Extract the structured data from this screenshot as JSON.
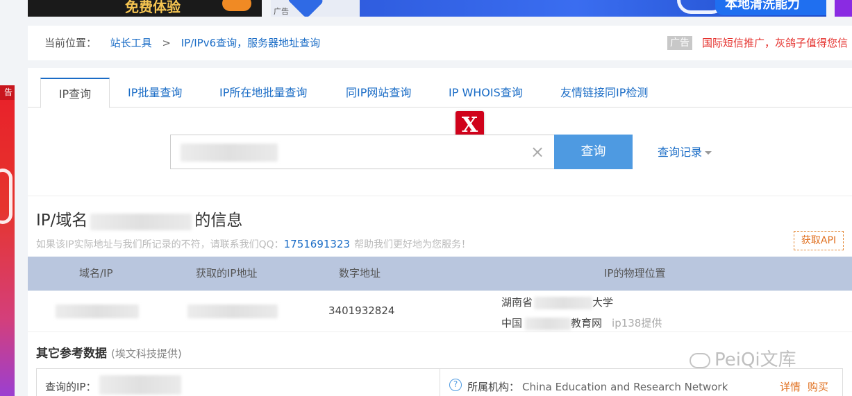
{
  "top_ads": {
    "ad1_text": "免费体验",
    "ad2_tag": "广告",
    "ad2_slogan": "本地清洗能力"
  },
  "side_ad": {
    "tag": "告"
  },
  "breadcrumb": {
    "prefix": "当前位置：",
    "items": [
      "站长工具",
      "IP/IPv6查询，服务器地址查询"
    ],
    "separator": ">",
    "ad_label": "广告",
    "ad_text": "国际短信推广，灰鸽子值得您信"
  },
  "tabs": [
    {
      "label": "IP查询",
      "active": true
    },
    {
      "label": "IP批量查询"
    },
    {
      "label": "IP所在地批量查询"
    },
    {
      "label": "同IP网站查询"
    },
    {
      "label": "IP WHOIS查询"
    },
    {
      "label": "友情链接同IP检测"
    }
  ],
  "overlay_badge": "X",
  "search": {
    "value": "",
    "clear_icon": "×",
    "button": "查询",
    "history": "查询记录"
  },
  "info": {
    "title_prefix": "IP/域名",
    "title_suffix": "的信息",
    "note_prefix": "如果该IP实际地址与我们所记录的不符，请联系我们QQ：",
    "qq": "1751691323",
    "note_suffix": "帮助我们更好地为您服务！",
    "api_button": "获取API"
  },
  "table": {
    "headers": [
      "域名/IP",
      "获取的IP地址",
      "数字地址",
      "IP的物理位置"
    ],
    "row": {
      "domain_ip": "",
      "ip": "",
      "numeric": "3401932824",
      "location_line1_a": "湖南省",
      "location_line1_b": "大学",
      "location_line2_a": "中国",
      "location_line2_b": "教育网",
      "provider": "ip138提供"
    }
  },
  "reference": {
    "title": "其它参考数据",
    "subtitle": "(埃文科技提供)",
    "query_ip_label": "查询的IP：",
    "org_label": "所属机构：",
    "org_value": "China Education and Research Network",
    "links": [
      "详情",
      "购买"
    ]
  },
  "watermark": "PeiQi文库",
  "colors": {
    "link_blue": "#1a6cc6",
    "button_blue": "#4e9ae1",
    "header_band": "#b9c6de",
    "ad_red": "#e5302c",
    "badge_red": "#d0021b",
    "orange": "#e07020"
  }
}
